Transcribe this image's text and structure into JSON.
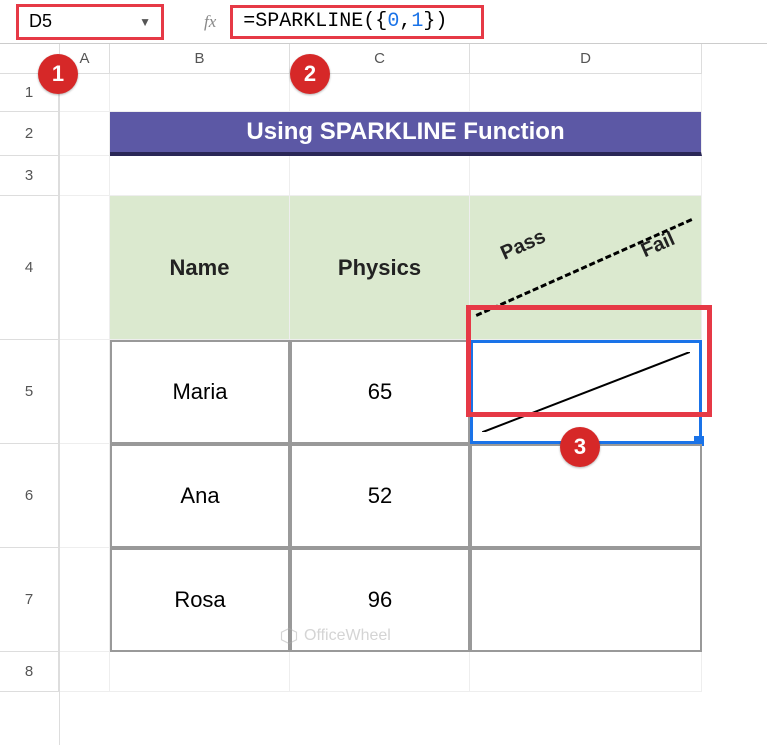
{
  "nameBox": "D5",
  "fxLabel": "fx",
  "formula": {
    "prefix": "=SPARKLINE({",
    "n1": "0",
    "comma": ",",
    "n2": "1",
    "suffix": "})"
  },
  "colHeaders": {
    "A": "A",
    "B": "B",
    "C": "C",
    "D": "D"
  },
  "rowHeaders": {
    "r1": "1",
    "r2": "2",
    "r3": "3",
    "r4": "4",
    "r5": "5",
    "r6": "6",
    "r7": "7",
    "r8": "8"
  },
  "title": "Using SPARKLINE Function",
  "tableHeaders": {
    "name": "Name",
    "physics": "Physics",
    "pass": "Pass",
    "fail": "Fail"
  },
  "rows": [
    {
      "name": "Maria",
      "physics": "65"
    },
    {
      "name": "Ana",
      "physics": "52"
    },
    {
      "name": "Rosa",
      "physics": "96"
    }
  ],
  "callouts": {
    "c1": "1",
    "c2": "2",
    "c3": "3"
  },
  "watermark": "OfficeWheel",
  "chart_data": {
    "type": "line",
    "x": [
      0,
      1
    ],
    "values": [
      0,
      1
    ],
    "title": "",
    "xlabel": "",
    "ylabel": ""
  }
}
